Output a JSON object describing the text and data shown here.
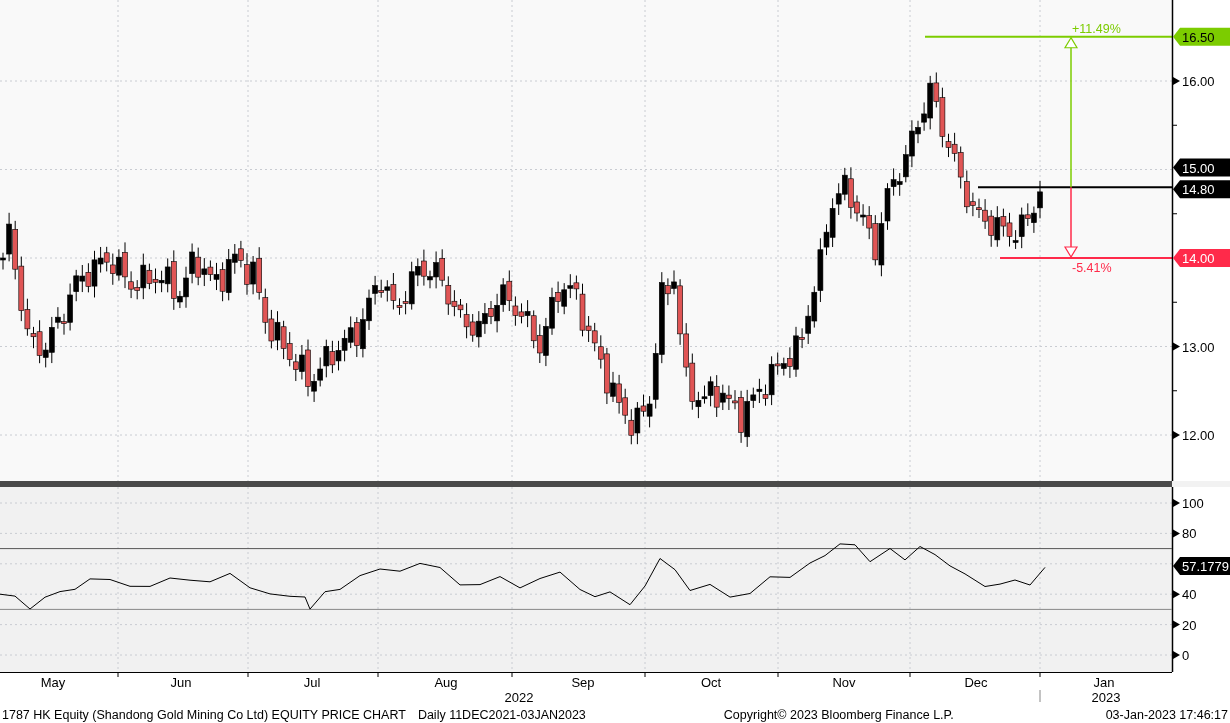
{
  "price_pane": {
    "ticks": [
      "16.00",
      "13.00",
      "12.00"
    ],
    "tags": [
      {
        "label": "16.50",
        "color": "#7ccc00"
      },
      {
        "label": "15.00",
        "color": "#000000"
      },
      {
        "label": "14.80",
        "color": "#000000"
      },
      {
        "label": "14.00",
        "color": "#ff2a4a"
      }
    ],
    "measurements": [
      {
        "label": "+11.49%",
        "color": "#7ccc00"
      },
      {
        "label": "-5.41%",
        "color": "#ff2a4a"
      }
    ]
  },
  "rsi_pane": {
    "ticks": [
      "100",
      "80",
      "40",
      "20",
      "0"
    ],
    "tags": [
      {
        "label": "57.1779",
        "color": "#000000"
      }
    ]
  },
  "months": [
    "May",
    "Jun",
    "Jul",
    "Aug",
    "Sep",
    "Oct",
    "Nov",
    "Dec",
    "Jan"
  ],
  "years": [
    "2022",
    "2023"
  ],
  "footer": {
    "title": "1787 HK Equity (Shandong Gold Mining Co Ltd) EQUITY PRICE CHART",
    "period": "Daily 11DEC2021-03JAN2023",
    "copyright": "Copyright© 2023 Bloomberg Finance L.P.",
    "timestamp": "03-Jan-2023 17:46:17"
  }
}
